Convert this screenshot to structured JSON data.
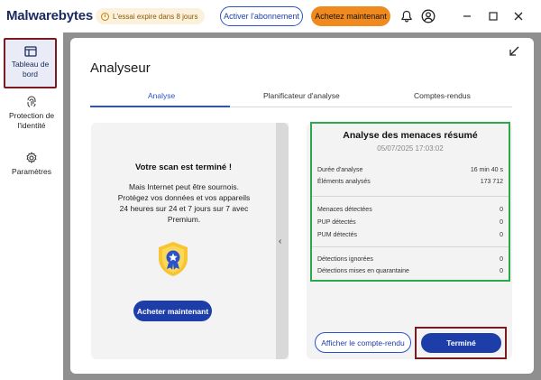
{
  "app": {
    "logo": "Malwarebytes",
    "trial": "L'essai expire dans 8 jours",
    "activate_button": "Activer l'abonnement",
    "buy_now_top": "Achetez maintenant",
    "brand_color": "#1d3ea8",
    "accent_color": "#f08a1e"
  },
  "sidebar": {
    "items": [
      {
        "label": "Tableau de bord",
        "icon": "dashboard-icon",
        "selected": true
      },
      {
        "label": "Protection de l'identité",
        "icon": "fingerprint-icon"
      },
      {
        "label": "Paramètres",
        "icon": "gear-icon"
      }
    ]
  },
  "main": {
    "title": "Analyseur",
    "tabs": [
      {
        "label": "Analyse",
        "active": true
      },
      {
        "label": "Planificateur d'analyse"
      },
      {
        "label": "Comptes-rendus"
      }
    ]
  },
  "promo": {
    "title": "Votre scan est terminé !",
    "text_lines": [
      "Mais Internet peut être sournois.",
      "Protégez vos données et vos appareils",
      "24 heures sur 24 et 7 jours sur 7 avec",
      "Premium."
    ],
    "buy_button": "Acheter maintenant"
  },
  "summary": {
    "title": "Analyse des menaces résumé",
    "date": "05/07/2025 17:03:02",
    "rows": [
      {
        "label": "Durée d'analyse",
        "value": "16 min 40 s"
      },
      {
        "label": "Éléments analysés",
        "value": "173 712"
      },
      {
        "label": "Menaces détectées",
        "value": "0"
      },
      {
        "label": "PUP détectés",
        "value": "0"
      },
      {
        "label": "PUM détectés",
        "value": "0"
      },
      {
        "label": "Détections ignorées",
        "value": "0"
      },
      {
        "label": "Détections mises en quarantaine",
        "value": "0"
      }
    ],
    "report_button": "Afficher le compte-rendu",
    "done_button": "Terminé",
    "status_color": "#2aa84a"
  }
}
